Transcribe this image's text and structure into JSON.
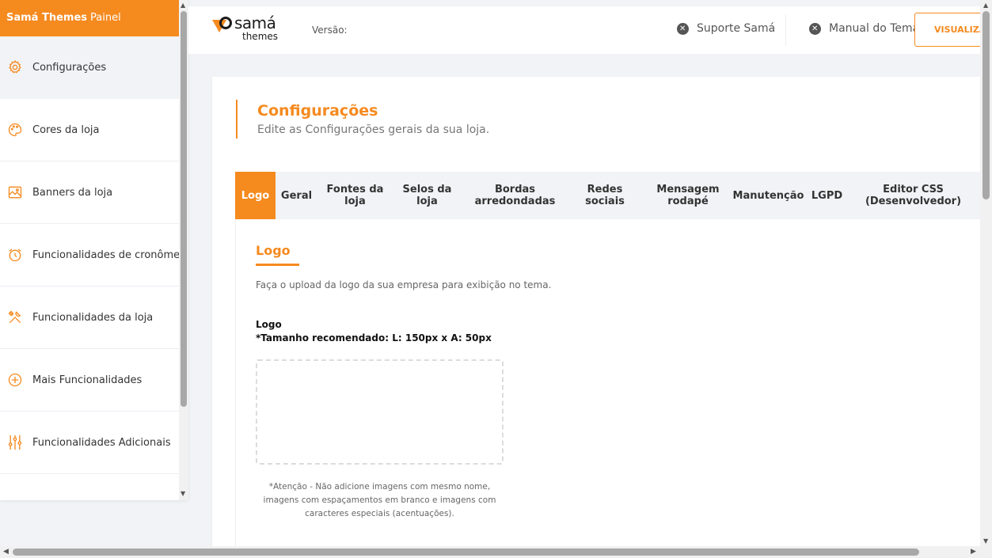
{
  "sidebar": {
    "brand": "Samá Themes",
    "brand_suffix": "Painel",
    "items": [
      {
        "label": "Configurações",
        "icon": "gear-icon"
      },
      {
        "label": "Cores da loja",
        "icon": "palette-icon"
      },
      {
        "label": "Banners da loja",
        "icon": "image-icon"
      },
      {
        "label": "Funcionalidades de cronômetro",
        "icon": "alarm-clock-icon"
      },
      {
        "label": "Funcionalidades da loja",
        "icon": "tools-icon"
      },
      {
        "label": "Mais Funcionalidades",
        "icon": "plus-circle-icon"
      },
      {
        "label": "Funcionalidades Adicionais",
        "icon": "sliders-icon"
      }
    ]
  },
  "header": {
    "logo_word1": "samá",
    "logo_word2": "themes",
    "version_label": "Versão:",
    "support_link": "Suporte Samá",
    "manual_link": "Manual do Tema",
    "preview_button": "VISUALIZAR"
  },
  "page": {
    "title": "Configurações",
    "subtitle": "Edite as Configurações gerais da sua loja."
  },
  "tabs": [
    {
      "line1": "Logo",
      "line2": ""
    },
    {
      "line1": "Geral",
      "line2": ""
    },
    {
      "line1": "Fontes da",
      "line2": "loja"
    },
    {
      "line1": "Selos da",
      "line2": "loja"
    },
    {
      "line1": "Bordas",
      "line2": "arredondadas"
    },
    {
      "line1": "Redes",
      "line2": "sociais"
    },
    {
      "line1": "Mensagem",
      "line2": "rodapé"
    },
    {
      "line1": "Manutenção",
      "line2": ""
    },
    {
      "line1": "LGPD",
      "line2": ""
    },
    {
      "line1": "Editor CSS",
      "line2": "(Desenvolvedor)"
    }
  ],
  "logo_panel": {
    "title": "Logo",
    "description": "Faça o upload da logo da sua empresa para exibição no tema.",
    "field_label": "Logo",
    "field_hint": "*Tamanho recomendado: L: 150px x A: 50px",
    "warning": "*Atenção - Não adicione imagens com mesmo nome, imagens com espaçamentos em branco e imagens com caracteres especiais (acentuações)."
  },
  "colors": {
    "accent": "#f58a1f",
    "background": "#f1f3f6"
  }
}
